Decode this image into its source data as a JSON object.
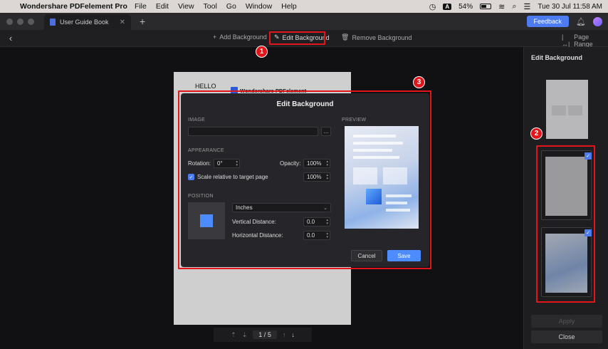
{
  "menubar": {
    "app_name": "Wondershare PDFelement Pro",
    "items": [
      "File",
      "Edit",
      "View",
      "Tool",
      "Go",
      "Window",
      "Help"
    ],
    "keyboard_badge": "A",
    "battery": "54%",
    "datetime": "Tue 30 Jul  11:58 AM"
  },
  "tabbar": {
    "tab_title": "User Guide Book",
    "feedback_label": "Feedback"
  },
  "toolbar": {
    "add_background": "Add Background",
    "edit_background": "Edit Background",
    "remove_background": "Remove Background",
    "page_range": "Page Range"
  },
  "annotations": {
    "badge1": "1",
    "badge2": "2",
    "badge3": "3"
  },
  "document": {
    "hello": "HELLO",
    "brand": "Wondershare PDFelement"
  },
  "pager": {
    "current": "1",
    "separator": "/",
    "total": "5"
  },
  "right_panel": {
    "title": "Edit Background",
    "apply_label": "Apply",
    "close_label": "Close"
  },
  "dialog": {
    "title": "Edit Background",
    "image_label": "IMAGE",
    "image_value": "",
    "browse_label": "...",
    "appearance_label": "APPEARANCE",
    "rotation_label": "Rotation:",
    "rotation_value": "0°",
    "opacity_label": "Opacity:",
    "opacity_value": "100%",
    "scale_label": "Scale relative to target page",
    "scale_value": "100%",
    "scale_checked": true,
    "position_label": "POSITION",
    "units_value": "Inches",
    "vertical_label": "Vertical Distance:",
    "vertical_value": "0.0",
    "horizontal_label": "Horizontal Distance:",
    "horizontal_value": "0.0",
    "preview_label": "PREVIEW",
    "cancel_label": "Cancel",
    "save_label": "Save"
  },
  "colors": {
    "accent": "#4c8cff",
    "highlight_red": "#e2151b"
  }
}
